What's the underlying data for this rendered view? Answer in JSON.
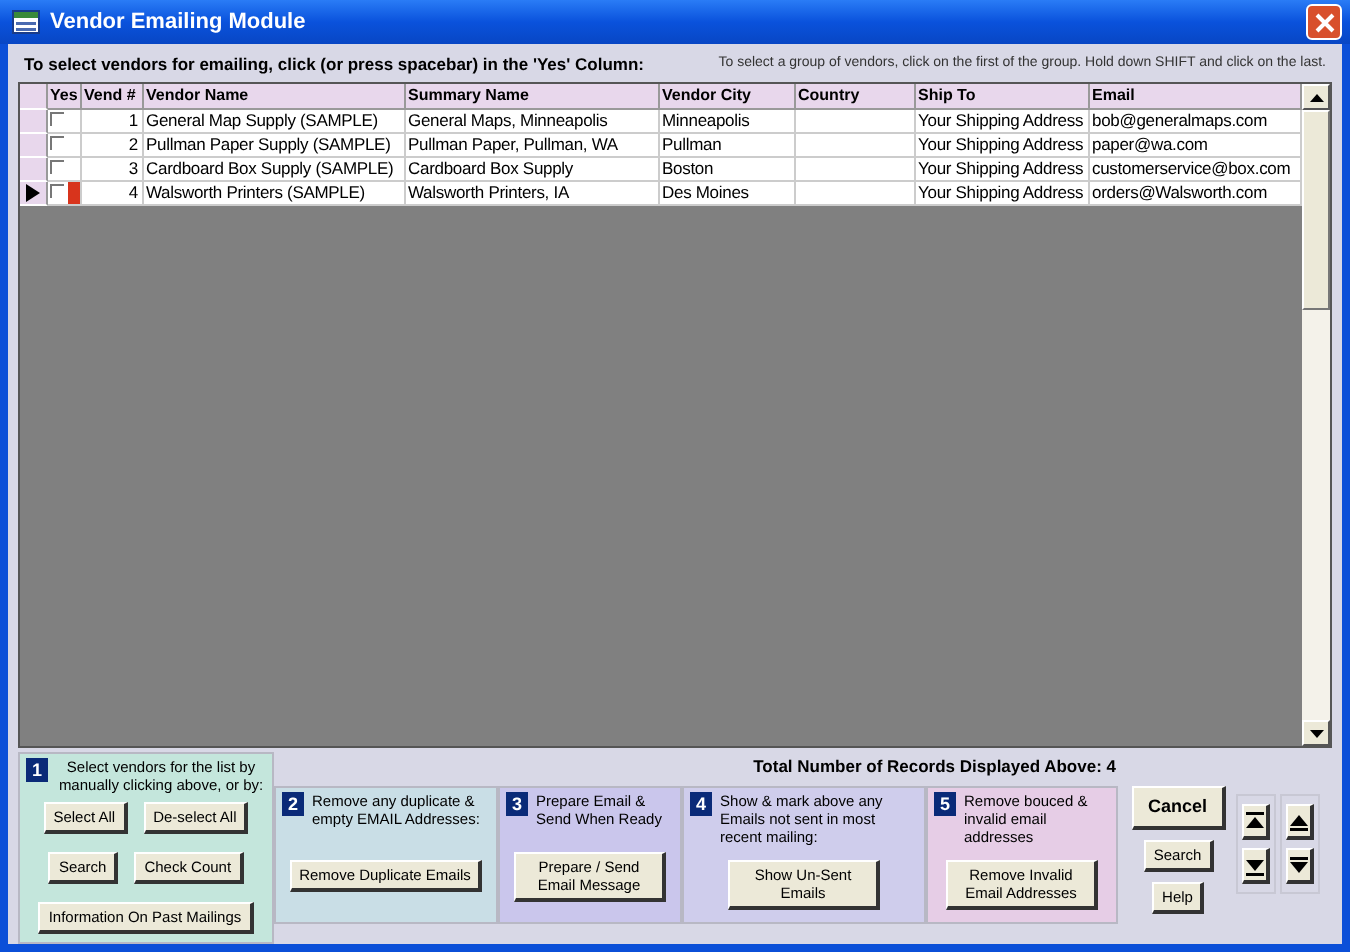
{
  "window": {
    "title": "Vendor Emailing Module"
  },
  "instruction": "To select vendors for emailing, click (or press spacebar) in the 'Yes' Column:",
  "hint": "To select a group of vendors, click on the first of the group.  Hold down SHIFT and click on the last.",
  "table": {
    "yes_column": "Yes",
    "columns": [
      "Vend #",
      "Vendor Name",
      "Summary Name",
      "Vendor City",
      "Country",
      "Ship To",
      "Email"
    ],
    "rows": [
      {
        "current": false,
        "yes": false,
        "cells": [
          "1",
          "General Map Supply (SAMPLE)",
          "General Maps, Minneapolis",
          "Minneapolis",
          "",
          "Your Shipping Address",
          "bob@generalmaps.com"
        ]
      },
      {
        "current": false,
        "yes": false,
        "cells": [
          "2",
          "Pullman Paper Supply (SAMPLE)",
          "Pullman Paper, Pullman, WA",
          "Pullman",
          "",
          "Your Shipping Address",
          "paper@wa.com"
        ]
      },
      {
        "current": false,
        "yes": false,
        "cells": [
          "3",
          "Cardboard Box Supply (SAMPLE)",
          "Cardboard Box Supply",
          "Boston",
          "",
          "Your Shipping Address",
          "customerservice@box.com"
        ]
      },
      {
        "current": true,
        "yes": false,
        "cells": [
          "4",
          "Walsworth Printers (SAMPLE)",
          "Walsworth Printers, IA",
          "Des Moines",
          "",
          "Your Shipping Address",
          "orders@Walsworth.com"
        ]
      }
    ]
  },
  "total": "Total Number of Records Displayed Above: 4",
  "steps": [
    {
      "number": "1",
      "text": "Select vendors for the list by manually clicking above, or by:",
      "color": "#c4e6dc",
      "buttons": [
        "Select All",
        "De-select All",
        "Search",
        "Check Count",
        "Information On Past Mailings"
      ]
    },
    {
      "number": "2",
      "text": "Remove any duplicate & empty EMAIL Addresses:",
      "color": "#c9dee6",
      "buttons": [
        "Remove Duplicate Emails"
      ]
    },
    {
      "number": "3",
      "text": "Prepare Email & Send When Ready",
      "color": "#cac6ec",
      "buttons": [
        "Prepare / Send Email Message"
      ]
    },
    {
      "number": "4",
      "text": "Show & mark above any Emails not sent in most recent mailing:",
      "color": "#cfcdec",
      "buttons": [
        "Show Un-Sent Emails"
      ]
    },
    {
      "number": "5",
      "text": "Remove bouced & invalid email addresses",
      "color": "#e6cde6",
      "buttons": [
        "Remove Invalid Email Addresses"
      ]
    }
  ],
  "side_buttons": [
    "Cancel",
    "Search",
    "Help"
  ]
}
